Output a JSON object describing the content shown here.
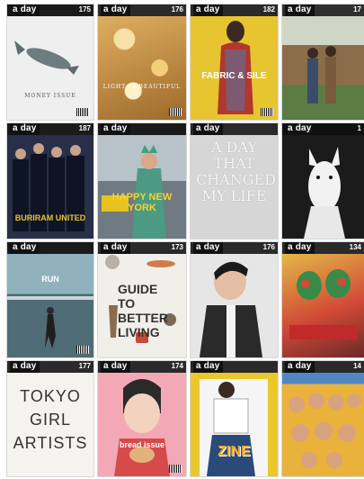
{
  "brand": "a day",
  "covers": [
    {
      "issue": "175",
      "headline": "MONEY ISSUE",
      "bg": "#efefef",
      "band": "#222222"
    },
    {
      "issue": "176",
      "headline": "LIGHT IS BEAUTIFUL",
      "bg": "#d7a24e",
      "band": "#2a2a2a"
    },
    {
      "issue": "182",
      "headline": "FABRIC & SILE",
      "bg": "#e7c531",
      "band": "#2a2a2a"
    },
    {
      "issue": "17",
      "headline": "",
      "bg": "#6f8f5c",
      "band": "#2f2f2f"
    },
    {
      "issue": "187",
      "headline": "BURIRAM UNITED",
      "bg": "#273048",
      "band": "#1b1b1b"
    },
    {
      "issue": "",
      "headline": "HAPPY NEW YORK",
      "bg": "#9aa7b1",
      "band": "#1b1b1b"
    },
    {
      "issue": "",
      "headline": "A DAY THAT CHANGED MY LIFE",
      "bg": "#d6d6d6",
      "band": "#2a2a2a"
    },
    {
      "issue": "1",
      "headline": "",
      "bg": "#1b1b1b",
      "band": "#111111"
    },
    {
      "issue": "",
      "headline": "RUN",
      "bg": "#6e8d98",
      "band": "#1b1b1b"
    },
    {
      "issue": "173",
      "headline": "GUIDE TO BETTER LIVING",
      "bg": "#f1efea",
      "band": "#2a2a2a"
    },
    {
      "issue": "176",
      "headline": "",
      "bg": "#e6e6e6",
      "band": "#2a2a2a"
    },
    {
      "issue": "134",
      "headline": "",
      "bg": "#d14a36",
      "band": "#2a2a2a"
    },
    {
      "issue": "177",
      "headline": "TOKYO GIRL ARTISTS",
      "bg": "#f5f3f0",
      "band": "#2a2a2a"
    },
    {
      "issue": "174",
      "headline": "bread issue",
      "bg": "#f2a9b5",
      "band": "#2a2a2a"
    },
    {
      "issue": "",
      "headline": "ZINE",
      "bg": "#e9c72d",
      "band": "#2a2a2a"
    },
    {
      "issue": "14",
      "headline": "",
      "bg": "#4f88c4",
      "band": "#2a2a2a"
    }
  ]
}
